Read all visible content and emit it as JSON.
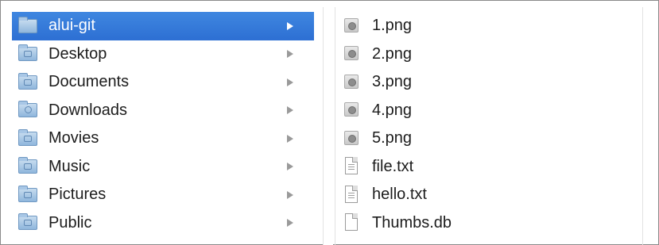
{
  "sidebar": {
    "items": [
      {
        "label": "alui-git",
        "icon": "folder-icon",
        "selected": true
      },
      {
        "label": "Desktop",
        "icon": "desktop-folder-icon"
      },
      {
        "label": "Documents",
        "icon": "documents-folder-icon"
      },
      {
        "label": "Downloads",
        "icon": "downloads-folder-icon"
      },
      {
        "label": "Movies",
        "icon": "movies-folder-icon"
      },
      {
        "label": "Music",
        "icon": "music-folder-icon"
      },
      {
        "label": "Pictures",
        "icon": "pictures-folder-icon"
      },
      {
        "label": "Public",
        "icon": "public-folder-icon"
      }
    ]
  },
  "files": {
    "items": [
      {
        "label": "1.png",
        "icon": "image-file-icon"
      },
      {
        "label": "2.png",
        "icon": "image-file-icon"
      },
      {
        "label": "3.png",
        "icon": "image-file-icon"
      },
      {
        "label": "4.png",
        "icon": "image-file-icon"
      },
      {
        "label": "5.png",
        "icon": "image-file-icon"
      },
      {
        "label": "file.txt",
        "icon": "text-file-icon"
      },
      {
        "label": "hello.txt",
        "icon": "text-file-icon"
      },
      {
        "label": "Thumbs.db",
        "icon": "blank-file-icon"
      }
    ]
  },
  "colors": {
    "selection": "#2d6fd3",
    "text": "#1c1c1c",
    "chevron": "#9a9a9a"
  }
}
